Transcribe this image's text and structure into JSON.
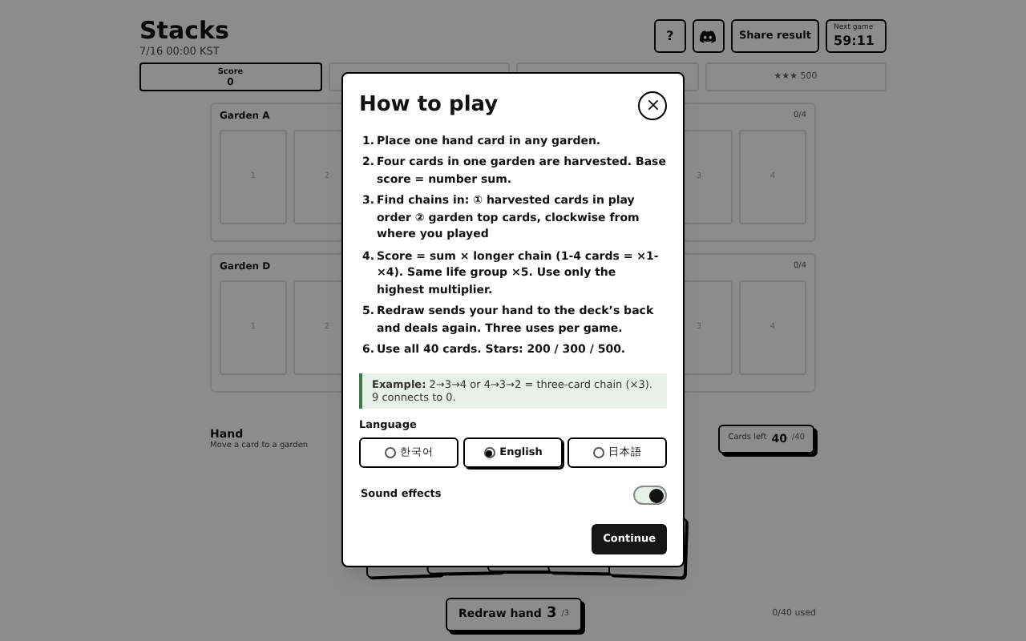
{
  "header": {
    "title": "Stacks",
    "subtitle": "7/16 00:00 KST",
    "buttons": [
      {
        "kind": "help",
        "label": "?"
      },
      {
        "kind": "discord"
      },
      {
        "kind": "share",
        "label": "Share result"
      }
    ],
    "next_game": {
      "label": "Next game",
      "value": "59:11"
    }
  },
  "score": {
    "label": "Score",
    "value": "0"
  },
  "star_goal": "★★★ 500",
  "gardens": [
    {
      "name": "Garden A",
      "count": "0/4",
      "slots": [
        "1",
        "2",
        "3",
        "4"
      ]
    },
    {
      "name": "Garden D",
      "count": "0/4",
      "slots": [
        "1",
        "2",
        "3",
        "4"
      ]
    }
  ],
  "hand": {
    "title": "Hand",
    "hint": "Move a card to a garden",
    "cards_left": {
      "label": "Cards left",
      "value": "40",
      "total": "/40"
    }
  },
  "redraw": {
    "label": "Redraw hand",
    "value": "3",
    "total": "/3"
  },
  "used": "0/40 used",
  "modal": {
    "title": "How to play",
    "rules": [
      {
        "number": "1.",
        "text": "Place one hand card in any garden."
      },
      {
        "number": "2.",
        "text": "Four cards in one garden are harvested. Base score = number sum."
      },
      {
        "number": "3.",
        "text": "Find chains in: ① harvested cards in play order ② garden top cards, clockwise from where you played"
      },
      {
        "number": "4.",
        "text": "Score = sum × longer chain (1-4 cards = ×1-×4). Same life group ×5. Use only the highest multiplier."
      },
      {
        "number": "5.",
        "text": "Redraw sends your hand to the deck’s back and deals again. Three uses per game."
      },
      {
        "number": "6.",
        "text": "Use all 40 cards. Stars: 200 / 300 / 500."
      }
    ],
    "example": "**Example:** 2→3→4 or 4→3→2 = three-card chain (×3). 9 connects to 0.",
    "language": {
      "label": "Language",
      "options": [
        {
          "label": "한국어",
          "selected": false
        },
        {
          "label": "English",
          "selected": true
        },
        {
          "label": "日本語",
          "selected": false
        }
      ]
    },
    "sound": {
      "label": "Sound effects",
      "on": true
    },
    "continue": "Continue"
  }
}
